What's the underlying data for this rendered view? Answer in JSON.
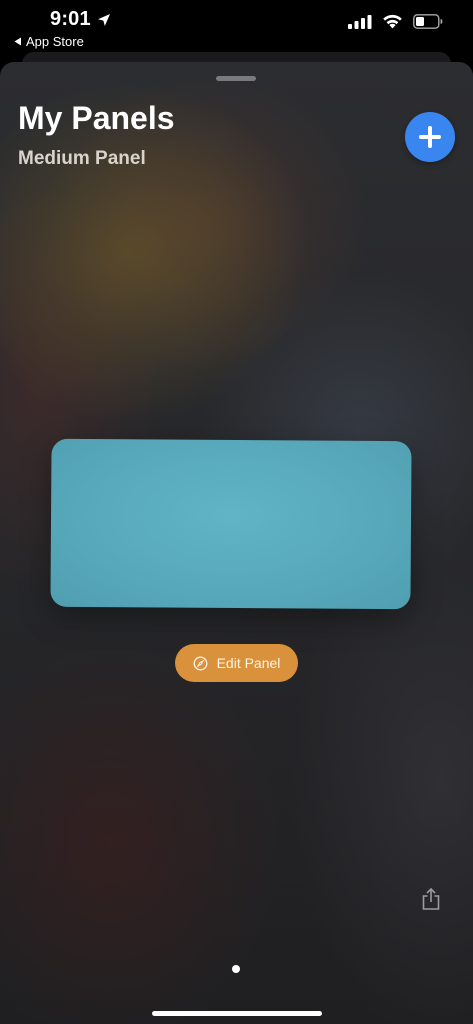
{
  "status_bar": {
    "time": "9:01",
    "back_label": "App Store",
    "icons": [
      "location-arrow-icon",
      "cellular-signal-icon",
      "wifi-icon",
      "battery-icon"
    ]
  },
  "sheet": {
    "title": "My Panels",
    "subtitle": "Medium Panel",
    "add_icon": "plus-icon",
    "panel_color": "#58a9bb",
    "edit_button": {
      "label": "Edit Panel",
      "icon": "compass-icon",
      "color": "#d9913b"
    },
    "share_icon": "share-icon",
    "accent_color": "#3a86f0"
  }
}
